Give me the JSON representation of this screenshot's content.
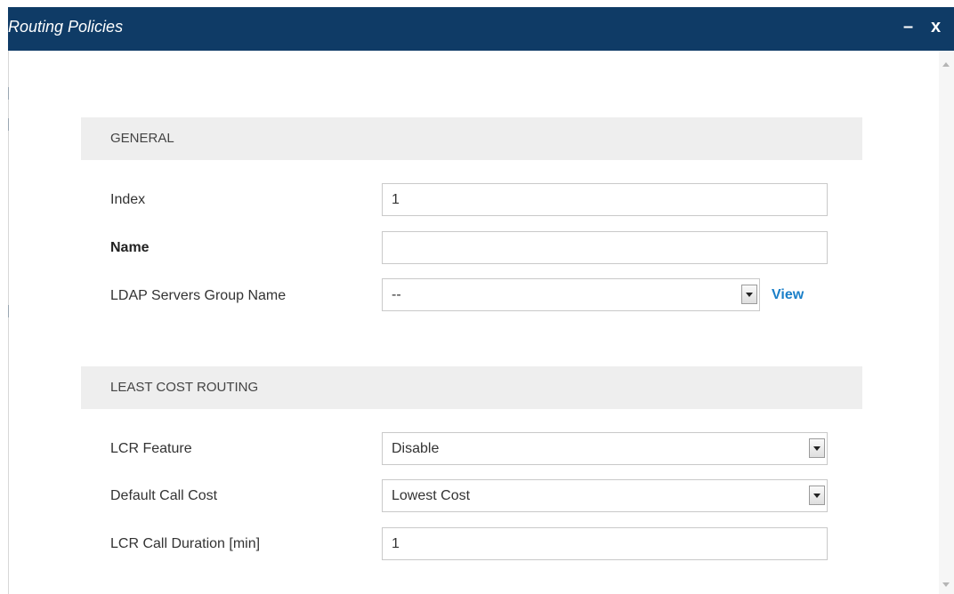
{
  "dialog": {
    "title": "Routing Policies",
    "minimize_label": "–",
    "close_label": "x"
  },
  "general": {
    "header": "GENERAL",
    "index_label": "Index",
    "index_value": "1",
    "name_label": "Name",
    "name_value": "",
    "ldap_label": "LDAP Servers Group Name",
    "ldap_value": "--",
    "view_label": "View"
  },
  "lcr": {
    "header": "LEAST COST ROUTING",
    "feature_label": "LCR Feature",
    "feature_value": "Disable",
    "default_cost_label": "Default Call Cost",
    "default_cost_value": "Lowest Cost",
    "duration_label": "LCR Call Duration [min]",
    "duration_value": "1"
  },
  "icons": {
    "minimize": "minimize-icon",
    "close": "close-icon",
    "dropdown": "chevron-down-icon"
  }
}
